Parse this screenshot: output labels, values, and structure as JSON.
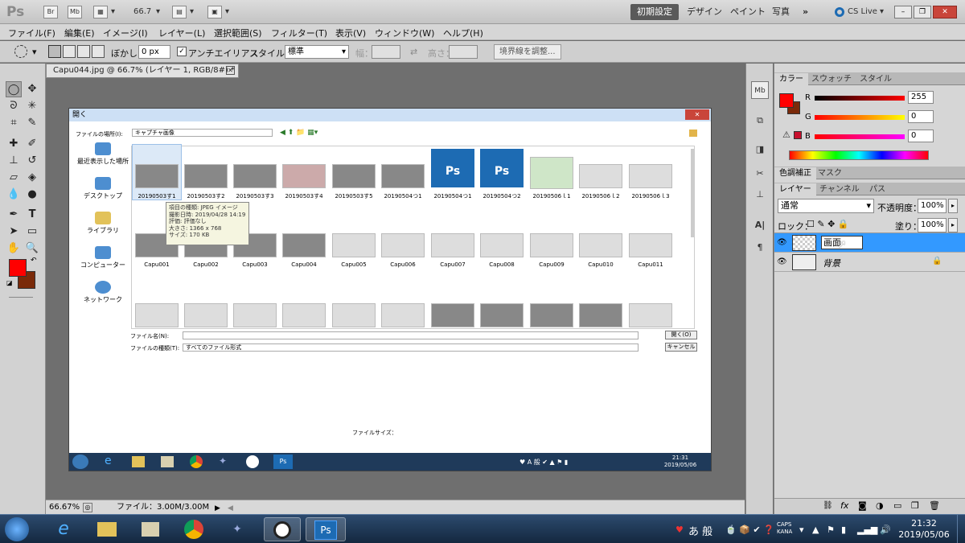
{
  "appbar": {
    "logo": "Ps",
    "zoom": "66.7",
    "workspaces": [
      "初期設定",
      "デザイン",
      "ペイント",
      "写真"
    ],
    "cslive": "CS Live"
  },
  "menu": [
    "ファイル(F)",
    "編集(E)",
    "イメージ(I)",
    "レイヤー(L)",
    "選択範囲(S)",
    "フィルター(T)",
    "表示(V)",
    "ウィンドウ(W)",
    "ヘルプ(H)"
  ],
  "options": {
    "feather_label": "ぼかし：",
    "feather_value": "0 px",
    "antialias_label": "アンチエイリアス",
    "style_label": "スタイル：",
    "style_value": "標準",
    "width_label": "幅：",
    "height_label": "高さ：",
    "refine_button": "境界線を調整..."
  },
  "document": {
    "tab_title": "Capu044.jpg @ 66.7% (レイヤー 1, RGB/8#) *",
    "zoom_status": "66.67%",
    "file_status": "ファイル：3.00M/3.00M"
  },
  "dialog": {
    "title": "開く",
    "lookin_label": "ファイルの場所(I):",
    "lookin_value": "キャプチャ画像",
    "places": [
      "最近表示した場所",
      "デスクトップ",
      "ライブラリ",
      "コンピューター",
      "ネットワーク"
    ],
    "row1": [
      "20190503す1",
      "20190503す2",
      "20190503す3",
      "20190503す4",
      "20190503す5",
      "20190504つ1",
      "20190504つ1",
      "20190504つ2",
      "20190506ｌ1",
      "20190506ｌ2",
      "20190506ｌ3"
    ],
    "row2": [
      "Capu001",
      "Capu002",
      "Capu003",
      "Capu004",
      "Capu005",
      "Capu006",
      "Capu007",
      "Capu008",
      "Capu009",
      "Capu010",
      "Capu011"
    ],
    "tooltip": [
      "項目の種類: JPEG イメージ",
      "撮影日時: 2019/04/28 14:19",
      "評価: 評価なし",
      "大きさ: 1366 x 768",
      "サイズ: 170 KB"
    ],
    "filename_label": "ファイル名(N):",
    "filetype_label": "ファイルの種類(T):",
    "filetype_value": "すべてのファイル形式",
    "open_button": "開く(O)",
    "cancel_button": "キャンセル",
    "filesize_label": "ファイルサイズ：",
    "inner_clock_time": "21:31",
    "inner_clock_date": "2019/05/06"
  },
  "color_panel": {
    "tabs": [
      "カラー",
      "スウォッチ",
      "スタイル"
    ],
    "r_label": "R",
    "g_label": "G",
    "b_label": "B",
    "r": "255",
    "g": "0",
    "b": "0"
  },
  "adjust_panel": {
    "tabs": [
      "色調補正",
      "マスク"
    ]
  },
  "layers_panel": {
    "tabs": [
      "レイヤー",
      "チャンネル",
      "パス"
    ],
    "blend_mode": "通常",
    "opacity_label": "不透明度：",
    "opacity": "100%",
    "lock_label": "ロック：",
    "fill_label": "塗り：",
    "fill": "100%",
    "layers": [
      {
        "name": "画面",
        "editing": true
      },
      {
        "name": "背景",
        "locked": true
      }
    ]
  },
  "taskbar": {
    "ime": "あ 般",
    "time": "21:32",
    "date": "2019/05/06"
  },
  "colors": {
    "foreground": "#ff0000",
    "background": "#7a2a0a",
    "selection": "#3399ff"
  }
}
